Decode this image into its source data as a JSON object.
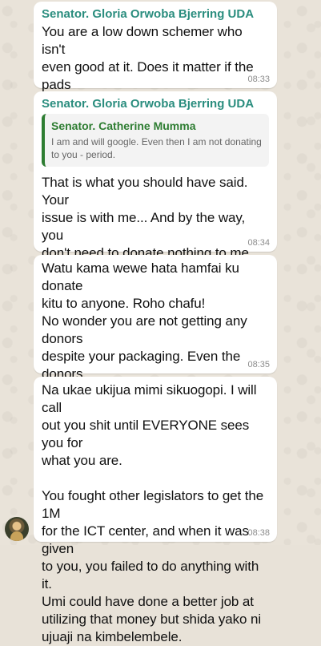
{
  "messages": [
    {
      "sender": "Senator. Gloria Orwoba Bjerring UDA",
      "text": "You are a low down schemer who isn't\neven good at it. Does it matter if the pads\nwill be distributed by Miraj or Miraj's\ncousin???",
      "time": "08:33"
    },
    {
      "sender": "Senator. Gloria Orwoba Bjerring UDA",
      "quote": {
        "sender": "Senator. Catherine Mumma",
        "text": "I am and will google. Even then I am not donating to\nyou - period."
      },
      "text": "That is what you should have said. Your\nissue is with me... And by the way, you\ndon't need to donate nothing to me.\nYou have probably laced whatever\ndonations with your dark spirit.",
      "time": "08:34"
    },
    {
      "text": "Watu kama wewe hata hamfai ku donate\nkitu to anyone. Roho chafu!\nNo wonder you are not getting any donors\ndespite your packaging. Even the donors\ncan smell a fake giver with bad intent.\nManeno ya community work wachia watu\nwa roho safi.",
      "time": "08:35"
    },
    {
      "text": "Na ukae ukijua mimi sikuogopi. I will call\nout you shit until EVERYONE sees you for\nwhat you are.\n\nYou fought other legislators to get the 1M\nfor the ICT center, and when it was given\nto you, you failed to do anything with it.\nUmi could have done a better job at\nutilizing that money but shida yako ni\nujuaji na kimbelembele.",
      "time": "08:38"
    }
  ]
}
